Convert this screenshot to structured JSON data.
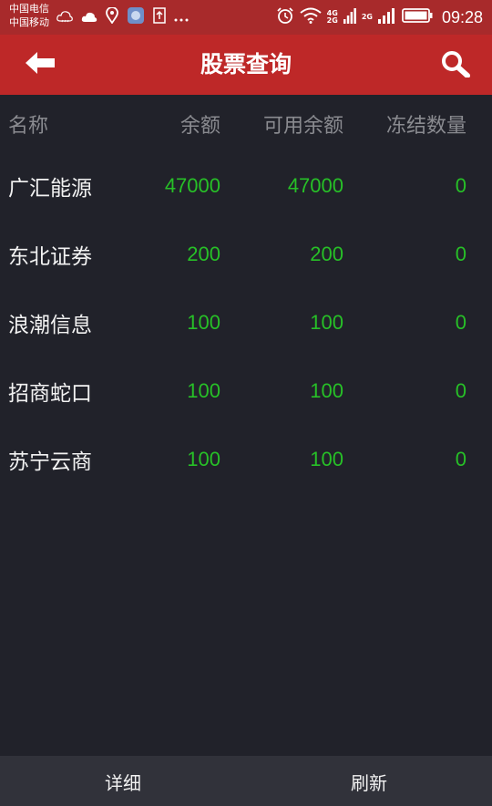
{
  "status_bar": {
    "carrier_1": "中国电信",
    "carrier_2": "中国移动",
    "net_4g": "4G",
    "net_2g_small": "2G",
    "net_2g": "2G",
    "time": "09:28"
  },
  "header": {
    "title": "股票查询",
    "back_icon": "back-arrow-icon",
    "search_icon": "search-icon"
  },
  "table": {
    "columns": [
      "名称",
      "余额",
      "可用余额",
      "冻结数量"
    ],
    "rows": [
      {
        "name": "广汇能源",
        "balance": "47000",
        "available": "47000",
        "frozen": "0"
      },
      {
        "name": "东北证券",
        "balance": "200",
        "available": "200",
        "frozen": "0"
      },
      {
        "name": "浪潮信息",
        "balance": "100",
        "available": "100",
        "frozen": "0"
      },
      {
        "name": "招商蛇口",
        "balance": "100",
        "available": "100",
        "frozen": "0"
      },
      {
        "name": "苏宁云商",
        "balance": "100",
        "available": "100",
        "frozen": "0"
      }
    ]
  },
  "bottom_bar": {
    "detail_label": "详细",
    "refresh_label": "刷新"
  },
  "colors": {
    "header_red": "#be2828",
    "background": "#21222a",
    "number_green": "#27c027"
  }
}
